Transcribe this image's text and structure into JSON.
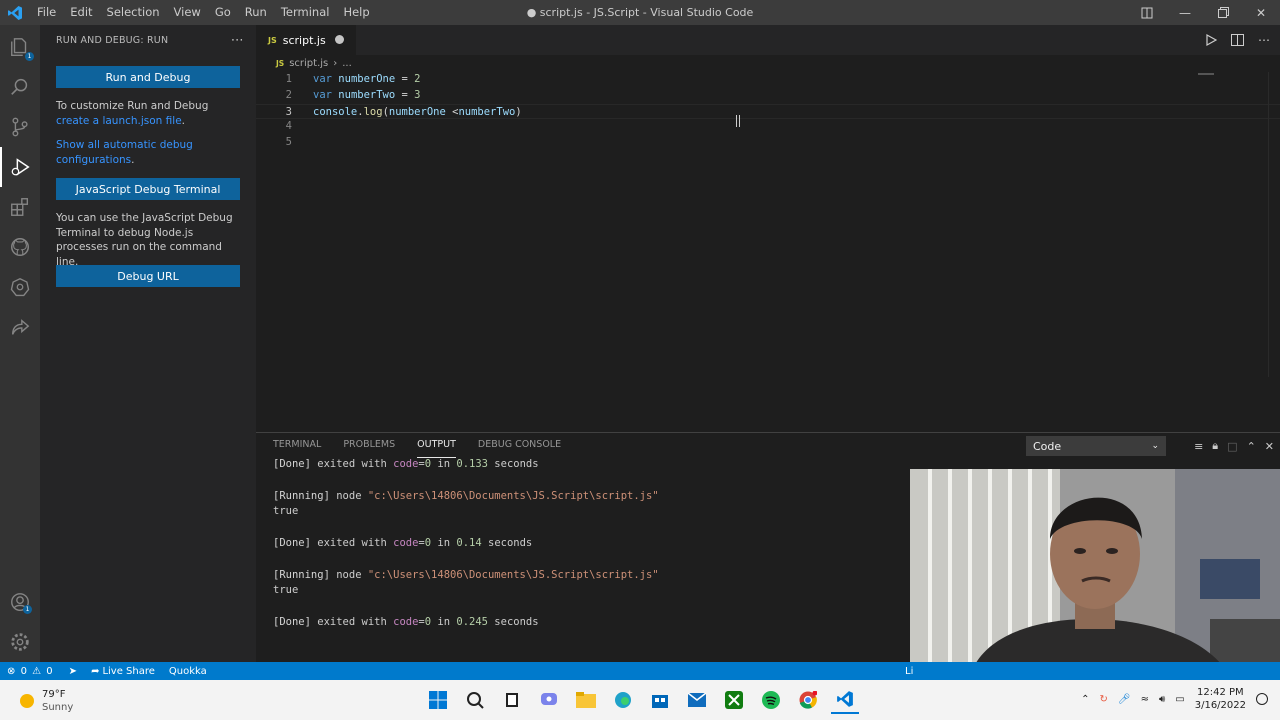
{
  "window": {
    "title": "● script.js - JS.Script - Visual Studio Code",
    "menu": [
      "File",
      "Edit",
      "Selection",
      "View",
      "Go",
      "Run",
      "Terminal",
      "Help"
    ]
  },
  "activity_bar": {
    "icons": [
      "explorer-icon",
      "search-icon",
      "source-control-icon",
      "run-debug-icon",
      "extensions-icon",
      "github-icon",
      "kubernetes-icon",
      "live-share-icon"
    ],
    "bottom_icons": [
      "accounts-icon",
      "settings-icon"
    ],
    "accounts_badge": "1"
  },
  "sidebar": {
    "title": "RUN AND DEBUG: RUN",
    "run_debug_button": "Run and Debug",
    "customize_text": "To customize Run and Debug",
    "customize_link": "create a launch.json file",
    "show_all_link": "Show all automatic debug configurations",
    "js_debug_terminal_button": "JavaScript Debug Terminal",
    "js_debug_text": "You can use the JavaScript Debug Terminal to debug Node.js processes run on the command line.",
    "debug_url_button": "Debug URL"
  },
  "editor": {
    "tab_label": "script.js",
    "breadcrumb_file": "script.js",
    "breadcrumb_rest": "...",
    "lines": [
      {
        "num": "1",
        "kw": "var",
        "name": "numberOne",
        "op": " = ",
        "value": "2"
      },
      {
        "num": "2",
        "kw": "var",
        "name": "numberTwo",
        "op": " = ",
        "value": "3"
      },
      {
        "num": "3",
        "obj": "console",
        "dot": ".",
        "fn": "log",
        "open": "(",
        "arg1": "numberOne",
        "mid": " <",
        "arg2": "numberTwo",
        "close": ")"
      },
      {
        "num": "4"
      },
      {
        "num": "5"
      }
    ]
  },
  "panel": {
    "tabs": [
      "TERMINAL",
      "PROBLEMS",
      "OUTPUT",
      "DEBUG CONSOLE"
    ],
    "active_tab": "OUTPUT",
    "channel": "Code",
    "output": [
      {
        "type": "done",
        "prefix": "[Done]",
        "text1": " exited with ",
        "kw": "code",
        "eq": "=",
        "code": "0",
        "text2": " in ",
        "secs": "0.133",
        "text3": " seconds"
      },
      {
        "type": "blank"
      },
      {
        "type": "run",
        "prefix": "[Running]",
        "text1": " node ",
        "path": "\"c:\\Users\\14806\\Documents\\JS.Script\\script.js\""
      },
      {
        "type": "plain",
        "text": "true"
      },
      {
        "type": "blank"
      },
      {
        "type": "done",
        "prefix": "[Done]",
        "text1": " exited with ",
        "kw": "code",
        "eq": "=",
        "code": "0",
        "text2": " in ",
        "secs": "0.14",
        "text3": " seconds"
      },
      {
        "type": "blank"
      },
      {
        "type": "run",
        "prefix": "[Running]",
        "text1": " node ",
        "path": "\"c:\\Users\\14806\\Documents\\JS.Script\\script.js\""
      },
      {
        "type": "plain",
        "text": "true"
      },
      {
        "type": "blank"
      },
      {
        "type": "done",
        "prefix": "[Done]",
        "text1": " exited with ",
        "kw": "code",
        "eq": "=",
        "code": "0",
        "text2": " in ",
        "secs": "0.245",
        "text3": " seconds"
      }
    ]
  },
  "statusbar": {
    "errors": "0",
    "warnings": "0",
    "live_share": "Live Share",
    "quokka": "Quokka",
    "right_fragment": "Li"
  },
  "taskbar": {
    "temp": "79°F",
    "weather": "Sunny",
    "time": "12:42 PM",
    "date": "3/16/2022"
  },
  "colors": {
    "accent": "#007acc",
    "button": "#0e639c",
    "link": "#3794ff"
  }
}
